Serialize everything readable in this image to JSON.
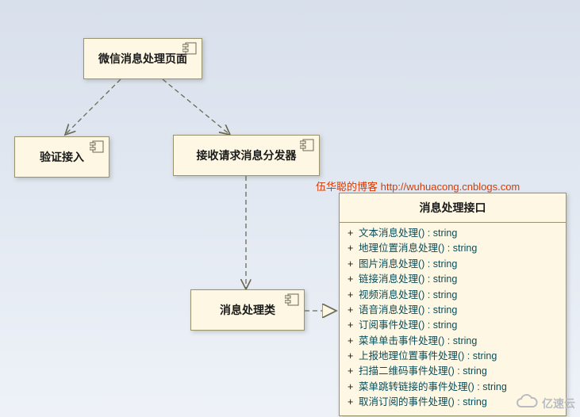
{
  "boxes": {
    "page": {
      "label": "微信消息处理页面"
    },
    "auth": {
      "label": "验证接入"
    },
    "dispatcher": {
      "label": "接收请求消息分发器"
    },
    "handler": {
      "label": "消息处理类"
    },
    "interface": {
      "title": "消息处理接口",
      "methods": [
        {
          "vis": "+",
          "name": "文本消息处理()",
          "ret": "string"
        },
        {
          "vis": "+",
          "name": "地理位置消息处理()",
          "ret": "string"
        },
        {
          "vis": "+",
          "name": "图片消息处理()",
          "ret": "string"
        },
        {
          "vis": "+",
          "name": "链接消息处理()",
          "ret": "string"
        },
        {
          "vis": "+",
          "name": "视频消息处理()",
          "ret": "string"
        },
        {
          "vis": "+",
          "name": "语音消息处理()",
          "ret": "string"
        },
        {
          "vis": "+",
          "name": "订阅事件处理()",
          "ret": "string"
        },
        {
          "vis": "+",
          "name": "菜单单击事件处理()",
          "ret": "string"
        },
        {
          "vis": "+",
          "name": "上报地理位置事件处理()",
          "ret": "string"
        },
        {
          "vis": "+",
          "name": "扫描二维码事件处理()",
          "ret": "string"
        },
        {
          "vis": "+",
          "name": "菜单跳转链接的事件处理()",
          "ret": "string"
        },
        {
          "vis": "+",
          "name": "取消订阅的事件处理()",
          "ret": "string"
        }
      ]
    }
  },
  "watermark": {
    "blog_label": "伍华聪的博客",
    "blog_url": "http://wuhuacong.cnblogs.com",
    "logo": "亿速云"
  }
}
